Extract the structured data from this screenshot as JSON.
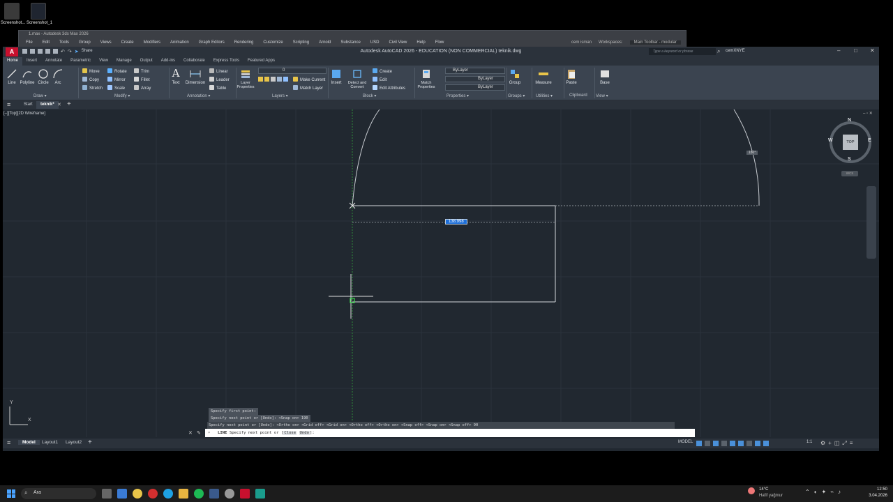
{
  "desktop": {
    "icons": [
      {
        "label": "Screenshot..."
      },
      {
        "label": "Screenshot_1"
      }
    ]
  },
  "max_window": {
    "title": "1.max - Autodesk 3ds Max 2026",
    "menu": [
      "File",
      "Edit",
      "Tools",
      "Group",
      "Views",
      "Create",
      "Modifiers",
      "Animation",
      "Graph Editors",
      "Rendering",
      "Customize",
      "Scripting",
      "Arnold",
      "Substance",
      "USD",
      "Civil View",
      "Help",
      "Flow"
    ],
    "user": "cem isman",
    "workspaces_label": "Workspaces:",
    "workspace_value": "Main Toolbar - modular"
  },
  "acad": {
    "title": "Autodesk AutoCAD 2026 - EDUCATION (NON COMMERCIAL)    teknik.dwg",
    "share_label": "Share",
    "search_placeholder": "Type a keyword or phrase",
    "user": "cemXNYE",
    "ribbon_tabs": [
      "Home",
      "Insert",
      "Annotate",
      "Parametric",
      "View",
      "Manage",
      "Output",
      "Add-ins",
      "Collaborate",
      "Express Tools",
      "Featured Apps"
    ],
    "draw": {
      "line": "Line",
      "polyline": "Polyline",
      "circle": "Circle",
      "arc": "Arc",
      "panel": "Draw ▾"
    },
    "modify": {
      "move": "Move",
      "rotate": "Rotate",
      "trim": "Trim",
      "copy": "Copy",
      "mirror": "Mirror",
      "fillet": "Fillet",
      "stretch": "Stretch",
      "scale": "Scale",
      "array": "Array",
      "panel": "Modify ▾"
    },
    "annotation": {
      "text": "Text",
      "dimension": "Dimension",
      "linear": "Linear",
      "leader": "Leader",
      "table": "Table",
      "panel": "Annotation ▾"
    },
    "layers": {
      "layer_props": "Layer Properties",
      "make_current": "Make Current",
      "match_layer": "Match Layer",
      "panel": "Layers ▾",
      "layer_value": "0"
    },
    "block": {
      "insert": "Insert",
      "detect": "Detect and Convert",
      "create": "Create",
      "edit": "Edit",
      "edit_attr": "Edit Attributes",
      "panel": "Block ▾"
    },
    "properties": {
      "match": "Match Properties",
      "bylayer1": "ByLayer",
      "bylayer2": "ByLayer",
      "bylayer3": "ByLayer",
      "panel": "Properties ▾"
    },
    "groups": {
      "group": "Group",
      "panel": "Groups ▾"
    },
    "utilities": {
      "measure": "Measure",
      "panel": "Utilities ▾"
    },
    "clipboard": {
      "paste": "Paste",
      "panel": "Clipboard"
    },
    "view": {
      "base": "Base",
      "panel": "View ▾"
    },
    "doc_tabs": {
      "start": "Start",
      "current": "teknik*"
    },
    "viewport_label": "[–][Top][2D Wireframe]",
    "viewcube": {
      "n": "N",
      "s": "S",
      "e": "E",
      "w": "W",
      "top": "TOP",
      "wcs": "WCS"
    },
    "dyn_input": "138.998",
    "angle_tip": "180°",
    "ucs": {
      "x": "X",
      "y": "Y"
    },
    "cmd_history": [
      "Specify first point:",
      "Specify next point or [Undo]:  <Snap on> 190",
      "Specify next point or [Undo]:  <Ortho on>  <Grid off>  <Grid on>  <Ortho off>  <Ortho on>  <Snap off>  <Snap on>  <Snap off> 90"
    ],
    "cmd_prompt_name": "LINE",
    "cmd_prompt": "Specify next point or [",
    "cmd_opt1": "Close",
    "cmd_opt2": "Undo",
    "cmd_end": "]:",
    "layout_tabs": [
      "Model",
      "Layout1",
      "Layout2"
    ],
    "status_model": "MODEL",
    "scale": "1:1"
  },
  "taskbar": {
    "search": "Ara",
    "weather_temp": "14°C",
    "weather_desc": "Hafif yağmur",
    "time": "12:50",
    "date": "3.04.2026"
  }
}
